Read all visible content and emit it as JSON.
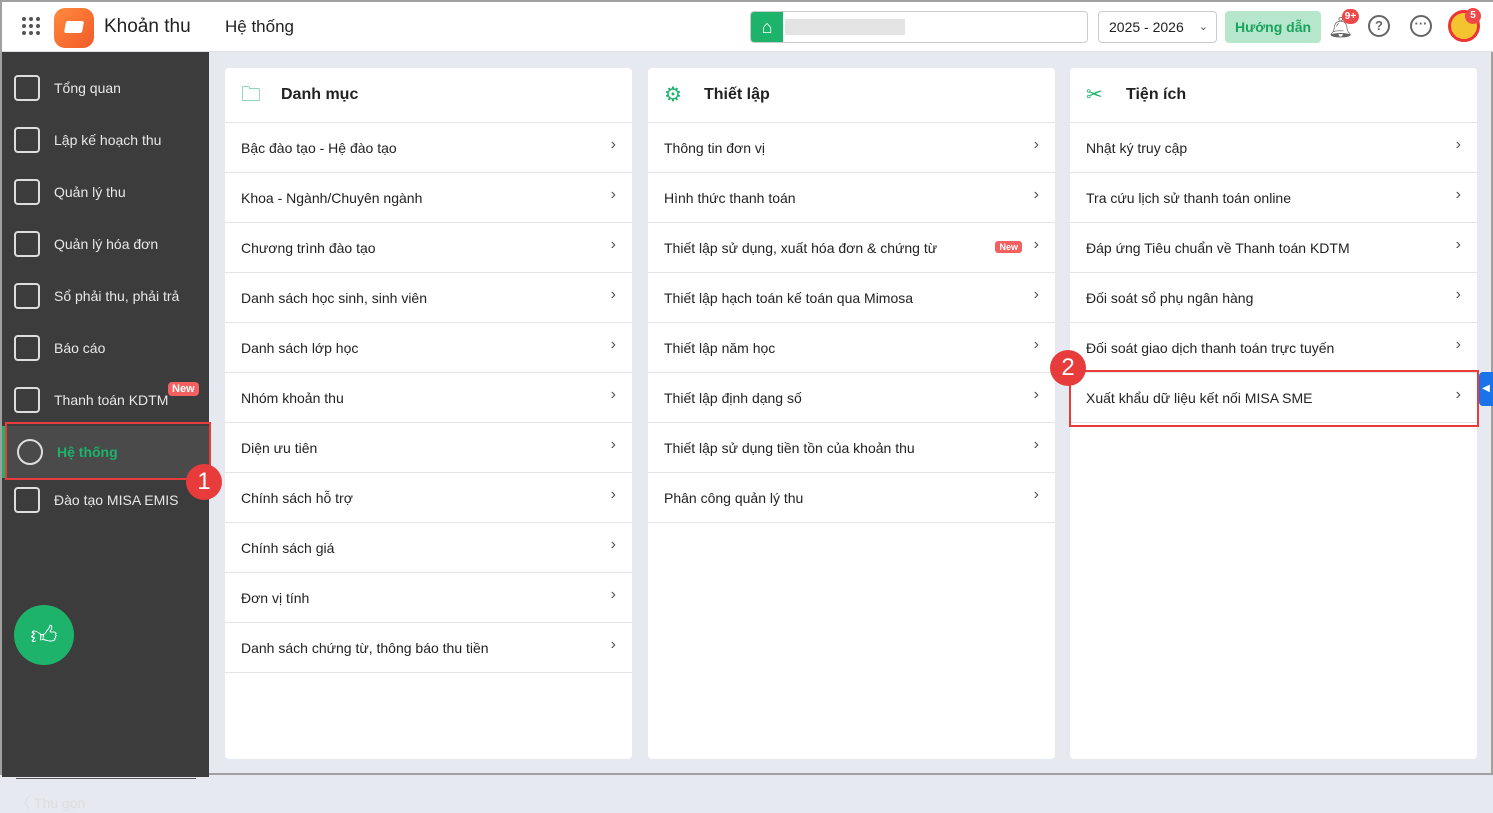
{
  "header": {
    "app_title": "Khoản thu",
    "page_title": "Hệ thống",
    "year": "2025 - 2026",
    "guide": "Hướng dẫn",
    "notif_count": "9+",
    "avatar_badge": "5"
  },
  "sidebar": {
    "items": [
      {
        "label": "Tổng quan",
        "icon": "chart-bar-icon"
      },
      {
        "label": "Lập kế hoạch thu",
        "icon": "calendar-money-icon"
      },
      {
        "label": "Quản lý thu",
        "icon": "hand-coin-icon"
      },
      {
        "label": "Quản lý hóa đơn",
        "icon": "invoice-icon"
      },
      {
        "label": "Sổ phải thu, phải trả",
        "icon": "ledger-icon"
      },
      {
        "label": "Báo cáo",
        "icon": "pie-chart-icon"
      },
      {
        "label": "Thanh toán KDTM",
        "icon": "card-check-icon"
      },
      {
        "label": "Hệ thống",
        "icon": "gear-icon"
      },
      {
        "label": "Đào tạo MISA EMIS",
        "icon": "book-icon"
      }
    ],
    "new_badge": "New",
    "collapse": "Thu gọn",
    "active": "Hệ thống"
  },
  "cards": [
    {
      "title": "Danh mục",
      "icon": "folder-icon",
      "items": [
        "Bậc đào tạo - Hệ đào tạo",
        "Khoa - Ngành/Chuyên ngành",
        "Chương trình đào tạo",
        "Danh sách học sinh, sinh viên",
        "Danh sách lớp học",
        "Nhóm khoản thu",
        "Diện ưu tiên",
        "Chính sách hỗ trợ",
        "Chính sách giá",
        "Đơn vị tính",
        "Danh sách chứng từ, thông báo thu tiền"
      ]
    },
    {
      "title": "Thiết lập",
      "icon": "gear-icon",
      "items": [
        "Thông tin đơn vị",
        "Hình thức thanh toán",
        "Thiết lập sử dụng, xuất hóa đơn & chứng từ",
        "Thiết lập hạch toán kế toán qua Mimosa",
        "Thiết lập năm học",
        "Thiết lập định dạng số",
        "Thiết lập sử dụng tiền tồn của khoản thu",
        "Phân công quản lý thu"
      ],
      "new_badge": "New"
    },
    {
      "title": "Tiện ích",
      "icon": "tools-icon",
      "items": [
        "Nhật ký truy cập",
        "Tra cứu lịch sử thanh toán online",
        "Đáp ứng Tiêu chuẩn về Thanh toán KDTM",
        "Đối soát sổ phụ ngân hàng",
        "Đối soát giao dịch thanh toán trực tuyến",
        "Xuất khẩu dữ liệu kết nối MISA SME"
      ]
    }
  ],
  "annotations": [
    "1",
    "2"
  ],
  "colors": {
    "accent": "#1db36b",
    "sidebar": "#3c3c3c",
    "annotation": "#e83c3c"
  }
}
